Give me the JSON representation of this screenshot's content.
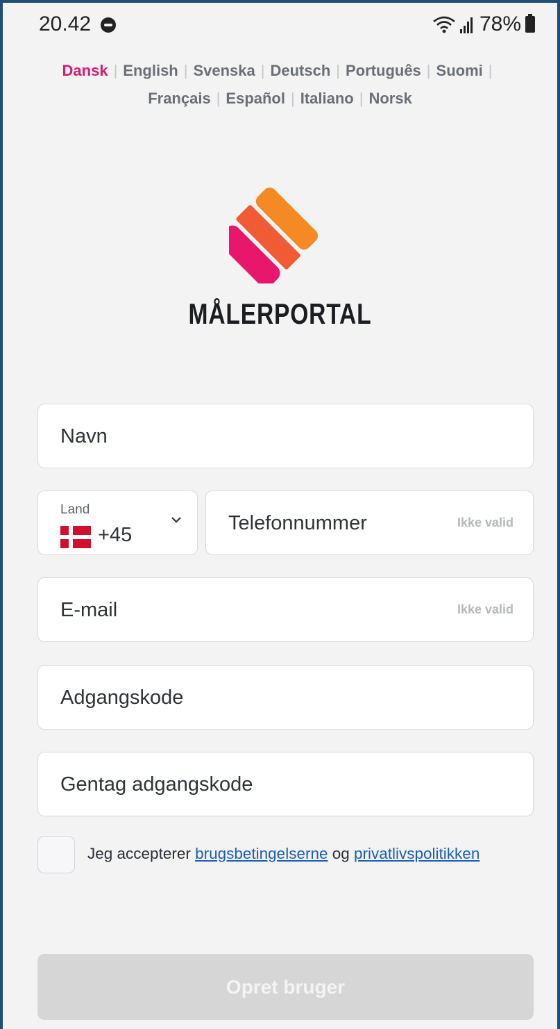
{
  "status_bar": {
    "time": "20.42",
    "battery_percent": "78%",
    "icons": [
      "do-not-disturb-icon",
      "wifi-icon",
      "signal-icon",
      "battery-icon"
    ]
  },
  "languages": {
    "active": "Dansk",
    "items": [
      "Dansk",
      "English",
      "Svenska",
      "Deutsch",
      "Português",
      "Suomi",
      "Français",
      "Español",
      "Italiano",
      "Norsk"
    ]
  },
  "brand": {
    "name": "MÅLERPORTAL",
    "colors": {
      "pink": "#e8176b",
      "red_orange": "#f05a34",
      "orange": "#f58a25"
    }
  },
  "form": {
    "name_placeholder": "Navn",
    "country_label": "Land",
    "country_code": "+45",
    "phone_placeholder": "Telefonnummer",
    "phone_hint": "Ikke valid",
    "email_placeholder": "E-mail",
    "email_hint": "Ikke valid",
    "password_placeholder": "Adgangskode",
    "password_repeat_placeholder": "Gentag adgangskode"
  },
  "terms": {
    "prefix": "Jeg accepterer ",
    "terms_link": "brugsbetingelserne",
    "middle": " og ",
    "privacy_link": "privatlivspolitikken",
    "checked": false
  },
  "submit": {
    "label": "Opret bruger",
    "enabled": false
  }
}
